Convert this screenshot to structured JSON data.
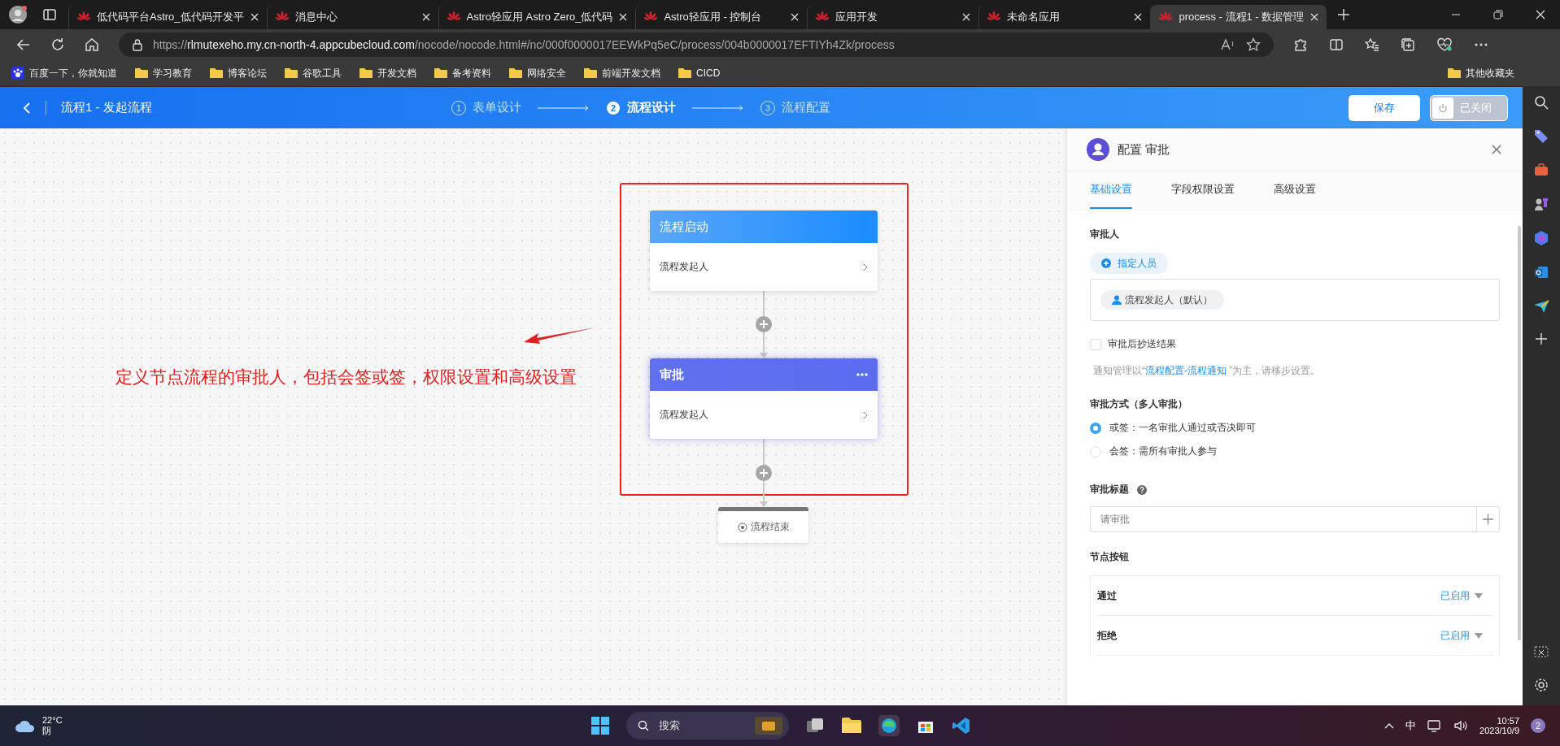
{
  "browser": {
    "tabs": [
      {
        "title": "低代码平台Astro_低代码开发平",
        "selected": false
      },
      {
        "title": "消息中心",
        "selected": false
      },
      {
        "title": "Astro轻应用 Astro Zero_低代码",
        "selected": false
      },
      {
        "title": "Astro轻应用 - 控制台",
        "selected": false
      },
      {
        "title": "应用开发",
        "selected": false
      },
      {
        "title": "未命名应用",
        "selected": false
      },
      {
        "title": "process - 流程1 - 数据管理",
        "selected": true
      }
    ],
    "url": {
      "scheme": "https://",
      "host": "rlmutexeho.my.cn-north-4.appcubecloud.com",
      "path": "/nocode/nocode.html#/nc/000f0000017EEWkPq5eC/process/004b0000017EFTIYh4Zk/process"
    },
    "bookmarks": [
      {
        "kind": "site",
        "label": "百度一下，你就知道"
      },
      {
        "kind": "folder",
        "label": "学习教育"
      },
      {
        "kind": "folder",
        "label": "博客论坛"
      },
      {
        "kind": "folder",
        "label": "谷歌工具"
      },
      {
        "kind": "folder",
        "label": "开发文档"
      },
      {
        "kind": "folder",
        "label": "备考资料"
      },
      {
        "kind": "folder",
        "label": "网络安全"
      },
      {
        "kind": "folder",
        "label": "前端开发文档"
      },
      {
        "kind": "folder",
        "label": "CICD"
      }
    ],
    "other_bookmarks": "其他收藏夹"
  },
  "header": {
    "title": "流程1 - 发起流程",
    "steps": [
      {
        "number": "1",
        "label": "表单设计",
        "selected": false
      },
      {
        "number": "2",
        "label": "流程设计",
        "selected": true
      },
      {
        "number": "3",
        "label": "流程配置",
        "selected": false
      }
    ],
    "save": "保存",
    "toggle": {
      "label": "已关闭",
      "on": false
    }
  },
  "canvas": {
    "nodes": [
      {
        "kind": "start",
        "title": "流程启动",
        "body": "流程发起人"
      },
      {
        "kind": "approval",
        "title": "审批",
        "body": "流程发起人"
      }
    ],
    "end": "流程结束",
    "annotation": "定义节点流程的审批人，包括会签或签，权限设置和高级设置"
  },
  "panel": {
    "title": "配置 审批",
    "tabs": [
      {
        "label": "基础设置",
        "selected": true
      },
      {
        "label": "字段权限设置",
        "selected": false
      },
      {
        "label": "高级设置",
        "selected": false
      }
    ],
    "approver_heading": "审批人",
    "assign_button": "指定人员",
    "approvers": [
      "流程发起人（默认）"
    ],
    "cc_result": {
      "label": "审批后抄送结果",
      "checked": false
    },
    "notice": {
      "before": "通知管理以“",
      "link": "流程配置-流程通知",
      "after": " ”为主，请移步设置。"
    },
    "method": {
      "heading": "审批方式（多人审批）",
      "options": [
        {
          "label": "或签：一名审批人通过或否决即可",
          "selected": true
        },
        {
          "label": "会签：需所有审批人参与",
          "selected": false
        }
      ]
    },
    "title_heading": "审批标题",
    "title_placeholder": "请审批",
    "buttons_heading": "节点按钮",
    "buttons": [
      {
        "name": "通过",
        "status": "已启用"
      },
      {
        "name": "拒绝",
        "status": "已启用"
      }
    ]
  },
  "taskbar": {
    "temperature": "22°C",
    "weather": "阴",
    "search": "搜索",
    "ime": "中",
    "time": "10:57",
    "date": "2023/10/9",
    "badge": "2"
  }
}
